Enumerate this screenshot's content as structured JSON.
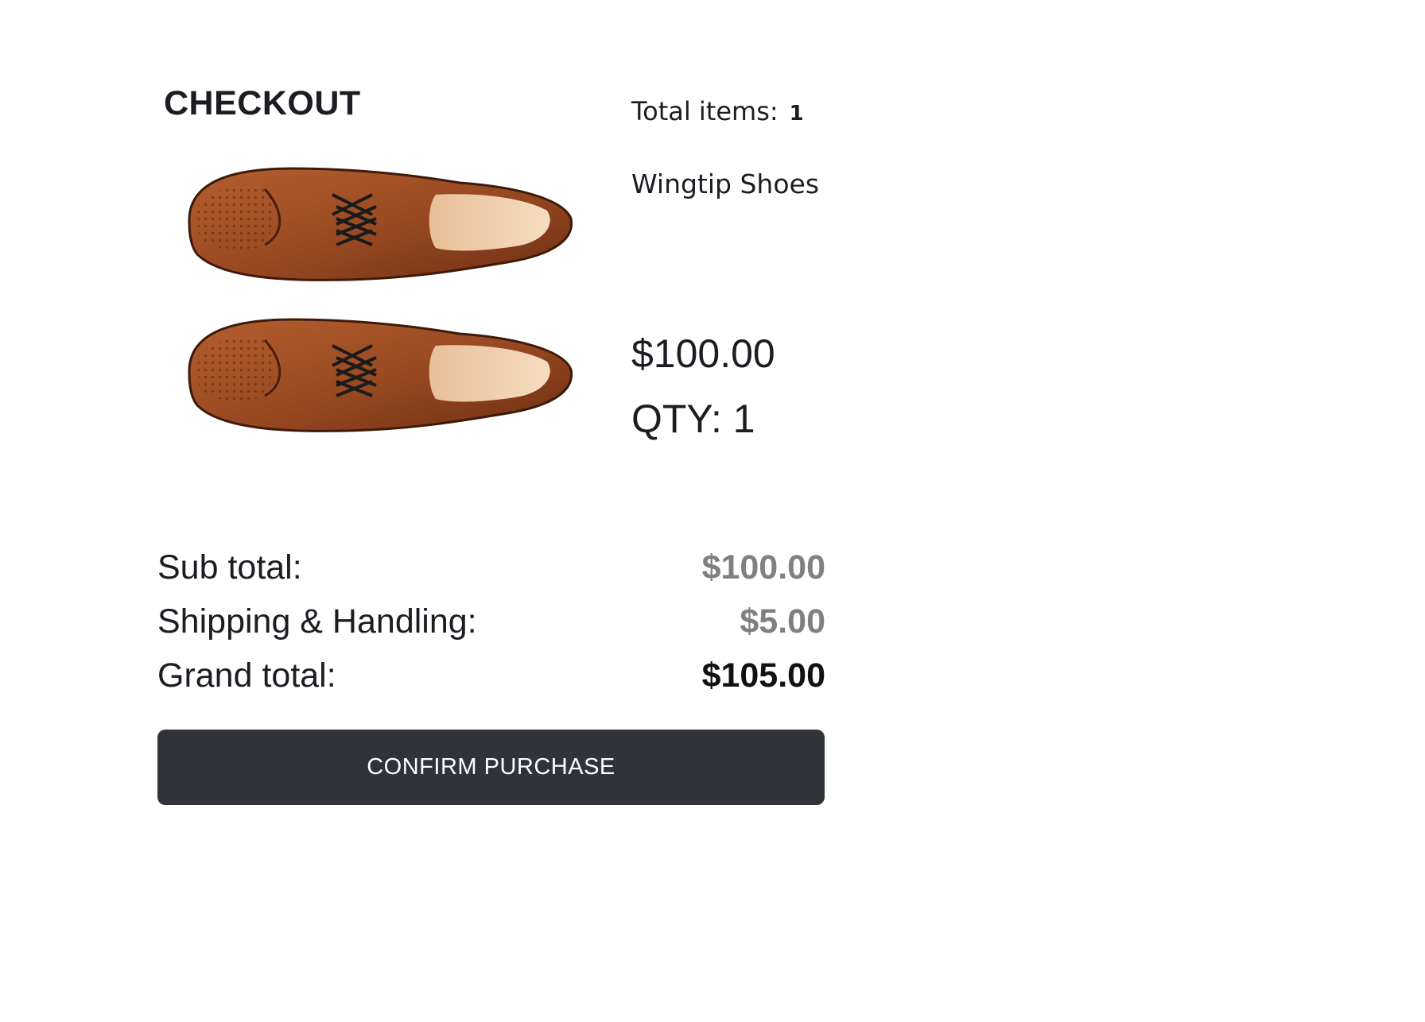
{
  "page": {
    "title": "CHECKOUT"
  },
  "cart": {
    "total_items_label": "Total items:",
    "total_items_count": "1"
  },
  "item": {
    "name": "Wingtip Shoes",
    "price": "$100.00",
    "qty_label": "QTY: 1",
    "image_icon": "wingtip-shoes-image"
  },
  "summary": {
    "subtotal_label": "Sub total:",
    "subtotal_value": "$100.00",
    "shipping_label": "Shipping & Handling:",
    "shipping_value": "$5.00",
    "grand_label": "Grand total:",
    "grand_value": "$105.00"
  },
  "actions": {
    "confirm_label": "CONFIRM PURCHASE"
  },
  "colors": {
    "button_bg": "#31333b",
    "muted_value": "#808080",
    "leather": "#9a4a22"
  }
}
